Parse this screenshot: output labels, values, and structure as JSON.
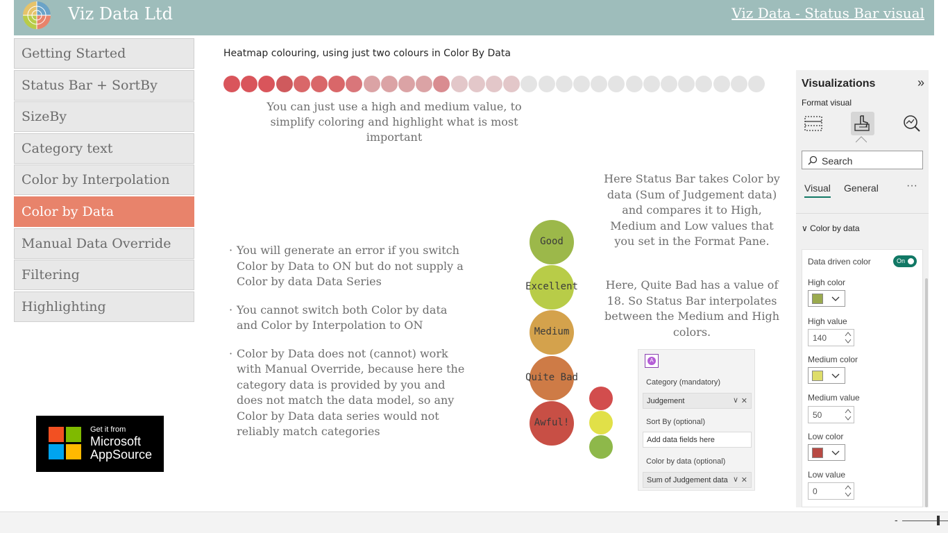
{
  "header": {
    "title": "Viz Data Ltd",
    "page_link": "Viz Data - Status Bar visual",
    "logo_icon": "pie-wheel-logo"
  },
  "sidebar": {
    "items": [
      {
        "label": "Getting Started",
        "active": false
      },
      {
        "label": "Status Bar + SortBy",
        "active": false
      },
      {
        "label": "SizeBy",
        "active": false
      },
      {
        "label": "Category text",
        "active": false
      },
      {
        "label": "Color by Interpolation",
        "active": false
      },
      {
        "label": "Color by Data",
        "active": true
      },
      {
        "label": "Manual Data Override",
        "active": false
      },
      {
        "label": "Filtering",
        "active": false
      },
      {
        "label": "Highlighting",
        "active": false
      }
    ],
    "active_color": "#e8836b"
  },
  "badge": {
    "line1": "Get it from",
    "line2": "Microsoft",
    "line3": "AppSource"
  },
  "main": {
    "heatmap_title": "Heatmap colouring, using just two colours in Color By Data",
    "heatmap_colors": [
      "#d9555b",
      "#d9555b",
      "#d9555b",
      "#cf5a5d",
      "#d96769",
      "#d96769",
      "#d96769",
      "#d9767a",
      "#dba3a5",
      "#dba3a5",
      "#dba3a5",
      "#dba3a5",
      "#d98c90",
      "#e3c7c9",
      "#e3c7c9",
      "#e3c7c9",
      "#e3c7c9",
      "#e4e4e4",
      "#e4e4e4",
      "#e4e4e4",
      "#e4e4e4",
      "#e4e4e4",
      "#e4e4e4",
      "#e4e4e4",
      "#e4e4e4",
      "#e4e4e4",
      "#e4e4e4",
      "#e4e4e4",
      "#e4e4e4",
      "#e4e4e4",
      "#e4e4e4"
    ],
    "caption": "You can just use a high and medium value, to simplify coloring and highlight what is most important",
    "bullets": [
      "You will generate an error if you switch Color by Data to ON but do not supply a Color by data Data Series",
      "You cannot switch both Color by data and Color by Interpolation to ON",
      "Color by Data does not (cannot) work with Manual Override, because here the category data is provided by you and does not match the data model, so any Color by Data data series would not reliably match categories"
    ],
    "right_text_1": "Here Status Bar takes Color by data (Sum of Judgement data) and compares it to High, Medium and Low values that you set in the Format Pane.",
    "right_text_2": "Here, Quite Bad has a value of 18. So Status Bar interpolates between the Medium and High colors.",
    "status_bar": [
      {
        "label": "Good",
        "color": "#9cb84a"
      },
      {
        "label": "Excellent",
        "color": "#b8cc48"
      },
      {
        "label": "Medium",
        "color": "#d4a24c"
      },
      {
        "label": "Quite Bad",
        "color": "#ce7b46"
      },
      {
        "label": "Awful!",
        "color": "#c84f45"
      }
    ],
    "legend_dots": [
      "#d24d4d",
      "#e1e048",
      "#8eb84a"
    ]
  },
  "fields": {
    "category_label": "Category (mandatory)",
    "category_value": "Judgement",
    "sortby_label": "Sort By (optional)",
    "sortby_placeholder": "Add data fields here",
    "colorby_label": "Color by data (optional)",
    "colorby_value": "Sum of Judgement data"
  },
  "viz_pane": {
    "title": "Visualizations",
    "collapse_icon": "double-chevron-right-icon",
    "subtitle": "Format visual",
    "search_placeholder": "Search",
    "tabs": [
      "Visual",
      "General"
    ],
    "more": "···",
    "section": "Color by data",
    "data_driven_label": "Data driven color",
    "toggle_label": "On",
    "high_color_label": "High color",
    "high_color": "#9aaa4e",
    "high_value_label": "High value",
    "high_value": "140",
    "medium_color_label": "Medium color",
    "medium_color": "#dedd6a",
    "medium_value_label": "Medium value",
    "medium_value": "50",
    "low_color_label": "Low color",
    "low_color": "#b84a44",
    "low_value_label": "Low value",
    "low_value": "0"
  },
  "bottom": {
    "zoom_minus": "-"
  }
}
